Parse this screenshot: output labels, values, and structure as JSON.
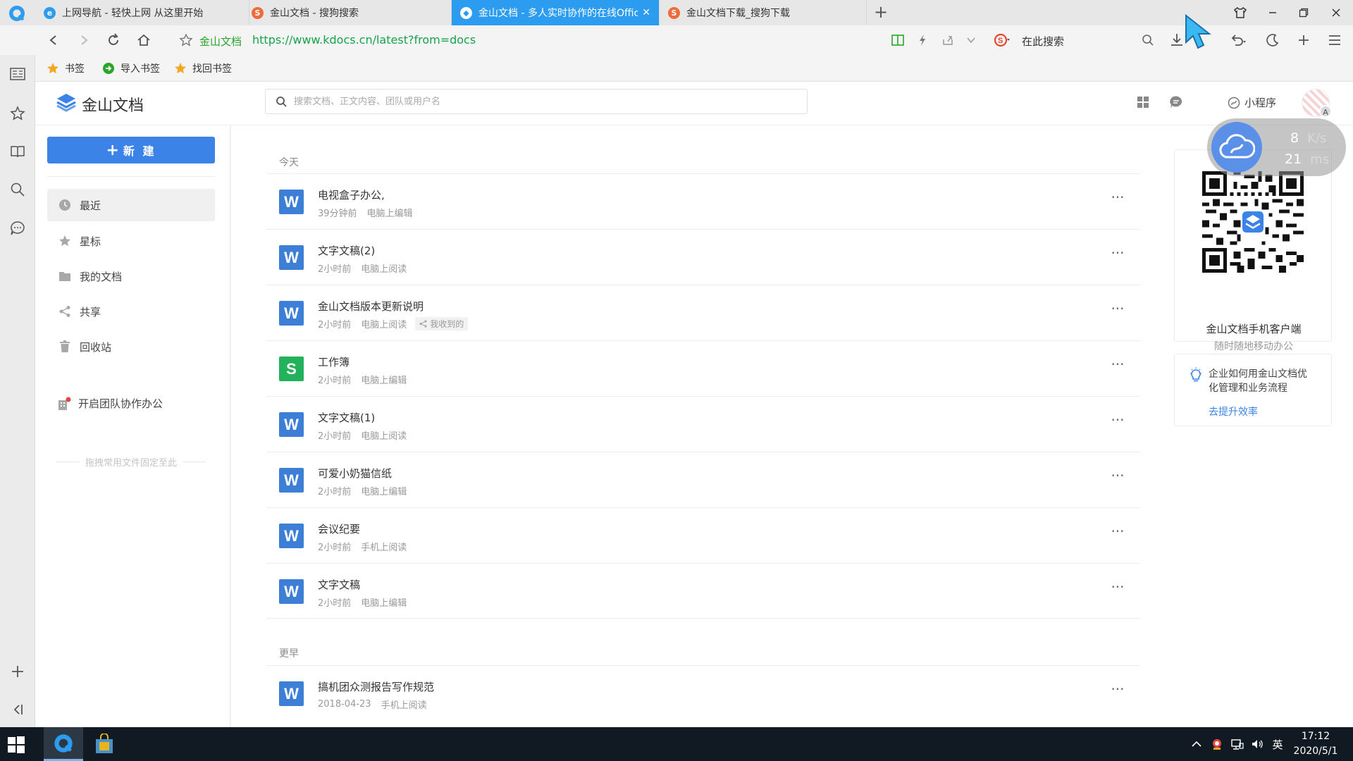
{
  "browser": {
    "tabs": [
      {
        "label": "上网导航 - 轻快上网 从这里开始"
      },
      {
        "label": "金山文档 - 搜狗搜索"
      },
      {
        "label": "金山文档 - 多人实时协作的在线Offic"
      },
      {
        "label": "金山文档下载_搜狗下载"
      }
    ],
    "new_tab": "+",
    "site_name": "金山文档",
    "url": "https://www.kdocs.cn/latest?from=docs",
    "search_engine_placeholder": "在此搜索",
    "bookmarks": [
      {
        "label": "书签",
        "icon": "star-icon"
      },
      {
        "label": "导入书签",
        "icon": "import-icon"
      },
      {
        "label": "找回书签",
        "icon": "star-icon"
      }
    ],
    "accent_color": "#2c9cf0"
  },
  "app": {
    "title": "金山文档",
    "search_placeholder": "搜索文档、正文内容、团队或用户名",
    "mini_program": "小程序",
    "avatar_badge": "A",
    "brand_color": "#3c83e8"
  },
  "sidebar": {
    "new_button": "新 建",
    "new_plus": "+",
    "items": [
      {
        "label": "最近",
        "icon": "clock-icon"
      },
      {
        "label": "星标",
        "icon": "star-icon"
      },
      {
        "label": "我的文档",
        "icon": "folder-icon"
      },
      {
        "label": "共享",
        "icon": "share-icon"
      },
      {
        "label": "回收站",
        "icon": "trash-icon"
      }
    ],
    "team_collab": "开启团队协作办公",
    "pin_hint": "拖拽常用文件固定至此"
  },
  "file_list": {
    "today_label": "今天",
    "earlier_label": "更早",
    "today": [
      {
        "type": "W",
        "name": "电视盒子办公,",
        "time": "39分钟前",
        "source": "电脑上编辑",
        "tag": ""
      },
      {
        "type": "W",
        "name": "文字文稿(2)",
        "time": "2小时前",
        "source": "电脑上阅读",
        "tag": ""
      },
      {
        "type": "W",
        "name": "金山文档版本更新说明",
        "time": "2小时前",
        "source": "电脑上阅读",
        "tag": "我收到的"
      },
      {
        "type": "S",
        "name": "工作簿",
        "time": "2小时前",
        "source": "电脑上编辑",
        "tag": ""
      },
      {
        "type": "W",
        "name": "文字文稿(1)",
        "time": "2小时前",
        "source": "电脑上阅读",
        "tag": ""
      },
      {
        "type": "W",
        "name": "可爱小奶猫信纸",
        "time": "2小时前",
        "source": "电脑上编辑",
        "tag": ""
      },
      {
        "type": "W",
        "name": "会议纪要",
        "time": "2小时前",
        "source": "手机上阅读",
        "tag": ""
      },
      {
        "type": "W",
        "name": "文字文稿",
        "time": "2小时前",
        "source": "电脑上编辑",
        "tag": ""
      }
    ],
    "earlier": [
      {
        "type": "W",
        "name": "搞机团众测报告写作规范",
        "time": "2018-04-23",
        "source": "手机上阅读",
        "tag": ""
      }
    ],
    "more_glyph": "···"
  },
  "right_panel": {
    "qr_title": "金山文档手机客户端",
    "qr_subtitle": "随时随地移动办公",
    "tip_text": "企业如何用金山文档优化管理和业务流程",
    "tip_link": "去提升效率"
  },
  "net_widget": {
    "speed_value": "8",
    "speed_unit": "K/s",
    "ping_value": "21",
    "ping_unit": "ms"
  },
  "taskbar": {
    "time": "17:12",
    "date": "2020/5/1",
    "ime": "英"
  }
}
